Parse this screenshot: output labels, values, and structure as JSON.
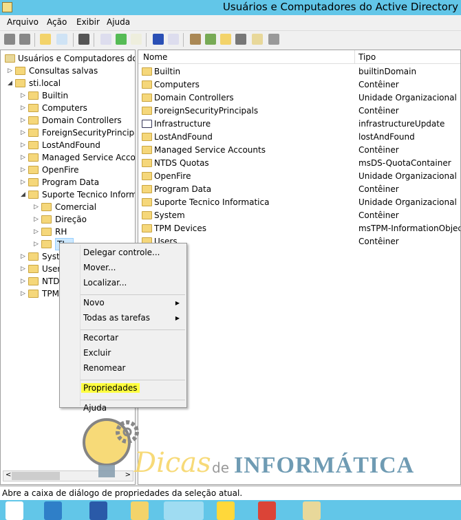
{
  "window": {
    "title": "Usuários e Computadores do Active Directory"
  },
  "menu": [
    "Arquivo",
    "Ação",
    "Exibir",
    "Ajuda"
  ],
  "toolbar_icons": [
    "back-icon",
    "forward-icon",
    "up-folder-icon",
    "show-hide-console-tree-icon",
    "clipboard-icon",
    "properties-icon",
    "refresh-icon",
    "export-list-icon",
    "help-icon",
    "show-action-pane-icon",
    "new-user-icon",
    "new-group-icon",
    "new-ou-icon",
    "filter-icon",
    "find-icon",
    "add-to-group-icon"
  ],
  "tree": [
    {
      "label": "Usuários e Computadores do Ac",
      "level": 0,
      "arrow": "",
      "icon": "ad-icon"
    },
    {
      "label": "Consultas salvas",
      "level": 1,
      "arrow": "▷"
    },
    {
      "label": "sti.local",
      "level": 1,
      "arrow": "◢"
    },
    {
      "label": "Builtin",
      "level": 2,
      "arrow": "▷"
    },
    {
      "label": "Computers",
      "level": 2,
      "arrow": "▷"
    },
    {
      "label": "Domain Controllers",
      "level": 2,
      "arrow": "▷"
    },
    {
      "label": "ForeignSecurityPrincipals",
      "level": 2,
      "arrow": "▷"
    },
    {
      "label": "LostAndFound",
      "level": 2,
      "arrow": "▷"
    },
    {
      "label": "Managed Service Accour",
      "level": 2,
      "arrow": "▷"
    },
    {
      "label": "OpenFire",
      "level": 2,
      "arrow": "▷"
    },
    {
      "label": "Program Data",
      "level": 2,
      "arrow": "▷"
    },
    {
      "label": "Suporte Tecnico Informa",
      "level": 2,
      "arrow": "◢"
    },
    {
      "label": "Comercial",
      "level": 3,
      "arrow": "▷"
    },
    {
      "label": "Direção",
      "level": 3,
      "arrow": "▷"
    },
    {
      "label": "RH",
      "level": 3,
      "arrow": "▷"
    },
    {
      "label": "TI",
      "level": 3,
      "arrow": "▷",
      "selected": true
    },
    {
      "label": "Syst",
      "level": 2,
      "arrow": "▷"
    },
    {
      "label": "User",
      "level": 2,
      "arrow": "▷"
    },
    {
      "label": "NTD",
      "level": 2,
      "arrow": "▷"
    },
    {
      "label": "TPM",
      "level": 2,
      "arrow": "▷"
    }
  ],
  "list": {
    "columns": [
      "Nome",
      "Tipo"
    ],
    "rows": [
      [
        "Builtin",
        "builtinDomain"
      ],
      [
        "Computers",
        "Contêiner"
      ],
      [
        "Domain Controllers",
        "Unidade Organizacional"
      ],
      [
        "ForeignSecurityPrincipals",
        "Contêiner"
      ],
      [
        "Infrastructure",
        "infrastructureUpdate"
      ],
      [
        "LostAndFound",
        "lostAndFound"
      ],
      [
        "Managed Service Accounts",
        "Contêiner"
      ],
      [
        "NTDS Quotas",
        "msDS-QuotaContainer"
      ],
      [
        "OpenFire",
        "Unidade Organizacional"
      ],
      [
        "Program Data",
        "Contêiner"
      ],
      [
        "Suporte Tecnico Informatica",
        "Unidade Organizacional"
      ],
      [
        "System",
        "Contêiner"
      ],
      [
        "TPM Devices",
        "msTPM-InformationObjects"
      ],
      [
        "Users",
        "Contêiner"
      ]
    ]
  },
  "context_menu": [
    {
      "label": "Delegar controle..."
    },
    {
      "label": "Mover..."
    },
    {
      "label": "Localizar..."
    },
    {
      "sep": true
    },
    {
      "label": "Novo",
      "submenu": true
    },
    {
      "label": "Todas as tarefas",
      "submenu": true
    },
    {
      "sep": true
    },
    {
      "label": "Recortar"
    },
    {
      "label": "Excluir"
    },
    {
      "label": "Renomear"
    },
    {
      "sep": true
    },
    {
      "label": "Propriedades",
      "highlight": "#ffff40"
    },
    {
      "sep": true
    },
    {
      "label": "Ajuda"
    }
  ],
  "status": "Abre a caixa de diálogo de propriedades da seleção atual.",
  "watermark": {
    "word1": "Dicas",
    "word2": "de",
    "word3": "INFORMÁTICA"
  },
  "taskbar": [
    "start-icon",
    "server-manager-icon",
    "powershell-icon",
    "file-explorer-icon",
    "ad-users-computers-icon",
    "lightbulb-icon",
    "chrome-icon",
    "notepad-icon"
  ],
  "colors": {
    "titlebar": "#62c6e8",
    "highlight": "#ffff40",
    "folder": "#f5d77a"
  }
}
